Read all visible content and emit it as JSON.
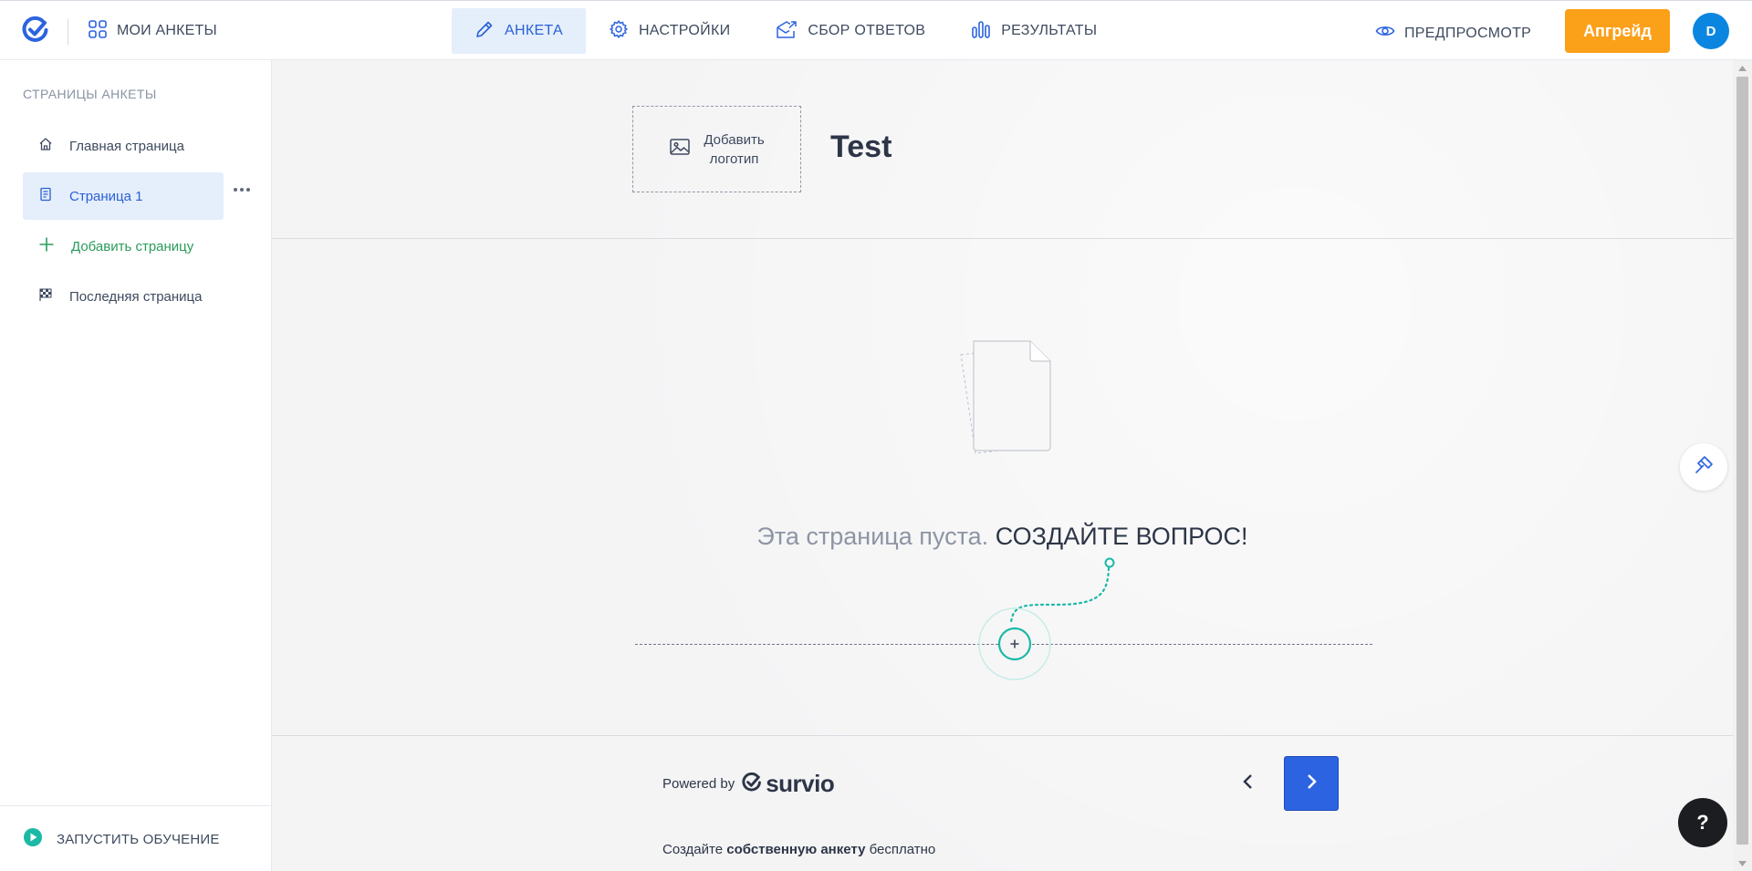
{
  "topbar": {
    "my_surveys": "МОИ АНКЕТЫ",
    "tabs": [
      {
        "label": "АНКЕТА",
        "icon": "pencil-icon",
        "active": true
      },
      {
        "label": "НАСТРОЙКИ",
        "icon": "gear-icon",
        "active": false
      },
      {
        "label": "СБОР ОТВЕТОВ",
        "icon": "send-envelope-icon",
        "active": false
      },
      {
        "label": "РЕЗУЛЬТАТЫ",
        "icon": "bar-chart-icon",
        "active": false
      }
    ],
    "preview": "ПРЕДПРОСМОТР",
    "upgrade": "Апгрейд",
    "avatar_initial": "D"
  },
  "sidebar": {
    "title": "СТРАНИЦЫ АНКЕТЫ",
    "items": [
      {
        "label": "Главная страница",
        "icon": "home-icon"
      },
      {
        "label": "Страница 1",
        "icon": "page-icon",
        "active": true
      },
      {
        "label": "Добавить страницу",
        "icon": "plus-icon"
      },
      {
        "label": "Последняя страница",
        "icon": "checkered-flag-icon"
      }
    ],
    "tutorial": "ЗАПУСТИТЬ ОБУЧЕНИЕ"
  },
  "main": {
    "add_logo": "Добавить логотип",
    "add_logo_line1": "Добавить",
    "add_logo_line2": "логотип",
    "survey_title": "Test",
    "empty_gray": "Эта страница пуста.",
    "empty_cta": "СОЗДАЙТЕ ВОПРОС!",
    "powered_by": "Powered by",
    "brand": "survio",
    "footer_pre": "Создайте",
    "footer_bold": "собственную анкету",
    "footer_post": "бесплатно",
    "help": "?"
  },
  "colors": {
    "accent_blue": "#2961d5",
    "active_bg": "#e5eefb",
    "upgrade_orange": "#fba019",
    "avatar_blue": "#0b86e0",
    "teal": "#1bb9a6",
    "add_green": "#2a9b5c",
    "next_button": "#2c63e0"
  }
}
